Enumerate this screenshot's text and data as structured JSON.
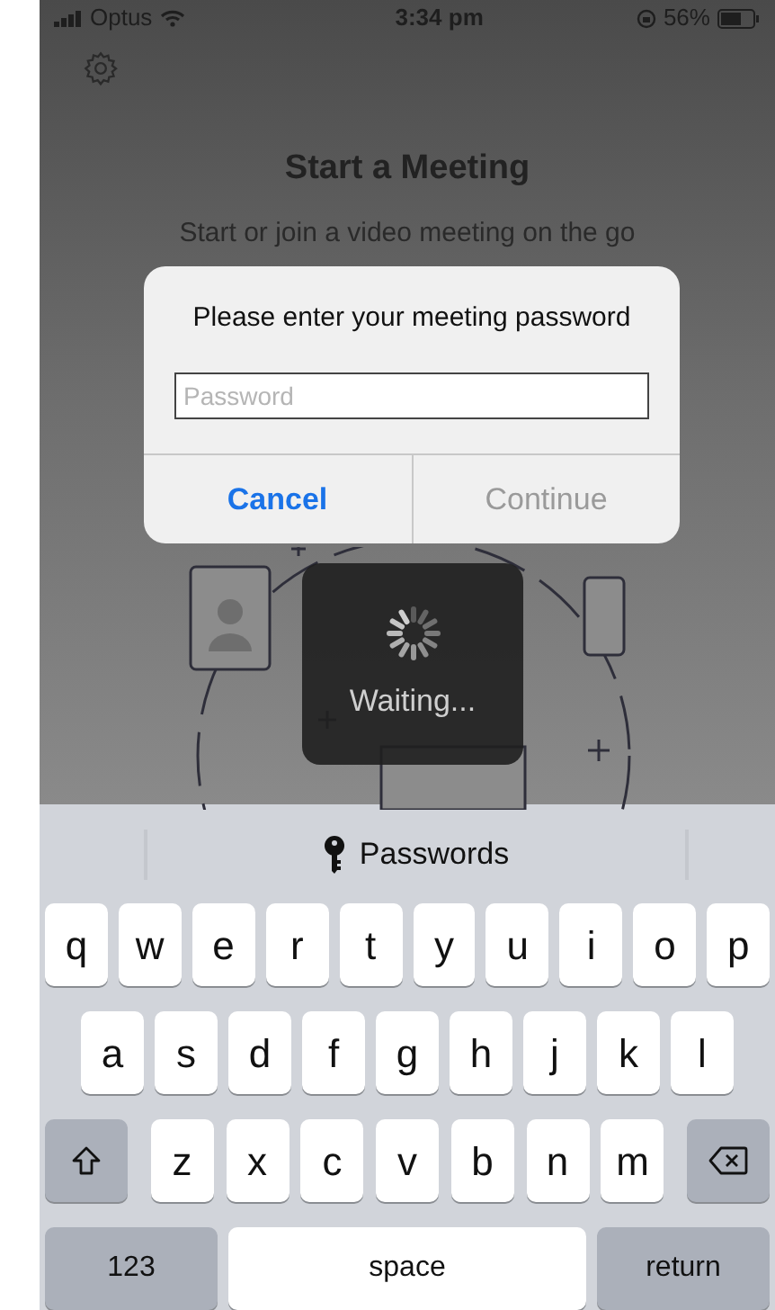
{
  "status_bar": {
    "carrier": "Optus",
    "time": "3:34 pm",
    "battery": "56%"
  },
  "heading": "Start a Meeting",
  "subtitle": "Start or join a video meeting on the go",
  "dialog": {
    "message": "Please enter your meeting password",
    "password_field": {
      "placeholder": "Password"
    },
    "buttons": [
      {
        "label": "Cancel",
        "kind": "cancel",
        "disabled": false
      },
      {
        "label": "Continue",
        "kind": "confirm",
        "disabled": true
      }
    ]
  },
  "hud": {
    "label": "Waiting..."
  },
  "keyboard": {
    "suggestion": "Passwords",
    "rows": [
      {
        "keys": [
          {
            "kind": "letter",
            "label": "q"
          },
          {
            "kind": "letter",
            "label": "w"
          },
          {
            "kind": "letter",
            "label": "e"
          },
          {
            "kind": "letter",
            "label": "r"
          },
          {
            "kind": "letter",
            "label": "t"
          },
          {
            "kind": "letter",
            "label": "y"
          },
          {
            "kind": "letter",
            "label": "u"
          },
          {
            "kind": "letter",
            "label": "i"
          },
          {
            "kind": "letter",
            "label": "o"
          },
          {
            "kind": "letter",
            "label": "p"
          }
        ]
      },
      {
        "keys": [
          {
            "kind": "letter",
            "label": "a"
          },
          {
            "kind": "letter",
            "label": "s"
          },
          {
            "kind": "letter",
            "label": "d"
          },
          {
            "kind": "letter",
            "label": "f"
          },
          {
            "kind": "letter",
            "label": "g"
          },
          {
            "kind": "letter",
            "label": "h"
          },
          {
            "kind": "letter",
            "label": "j"
          },
          {
            "kind": "letter",
            "label": "k"
          },
          {
            "kind": "letter",
            "label": "l"
          }
        ]
      },
      {
        "keys": [
          {
            "kind": "shift"
          },
          {
            "kind": "letter",
            "label": "z"
          },
          {
            "kind": "letter",
            "label": "x"
          },
          {
            "kind": "letter",
            "label": "c"
          },
          {
            "kind": "letter",
            "label": "v"
          },
          {
            "kind": "letter",
            "label": "b"
          },
          {
            "kind": "letter",
            "label": "n"
          },
          {
            "kind": "letter",
            "label": "m"
          },
          {
            "kind": "delete"
          }
        ]
      }
    ],
    "bottom_row": {
      "numbers_key": "123",
      "space_key": "space",
      "return_key": "return"
    }
  }
}
